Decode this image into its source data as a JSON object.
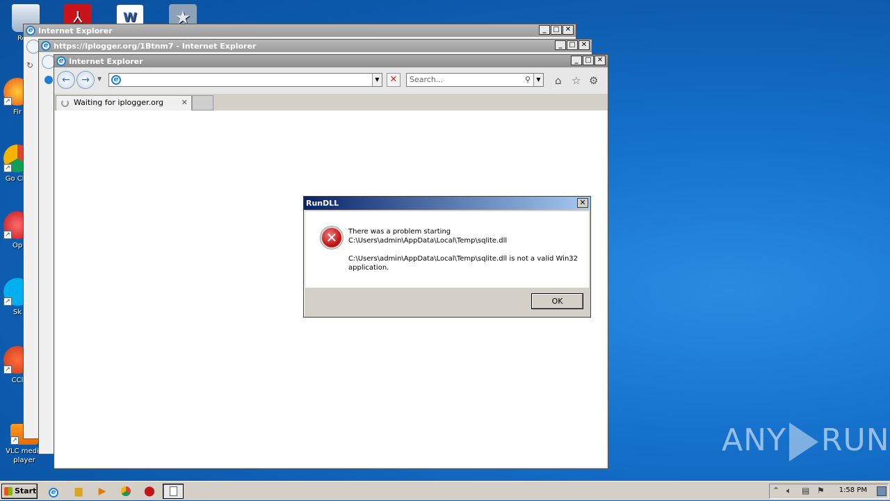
{
  "desktop_icons": [
    {
      "id": "recycle",
      "label": "Recy"
    },
    {
      "id": "acrobat",
      "label": ""
    },
    {
      "id": "word",
      "label": ""
    },
    {
      "id": "star",
      "label": ""
    },
    {
      "id": "firefox",
      "label": "Fir"
    },
    {
      "id": "chrome",
      "label": "Go Chr"
    },
    {
      "id": "opera",
      "label": "Op"
    },
    {
      "id": "skype",
      "label": "Sk"
    },
    {
      "id": "ccleaner",
      "label": "CCl"
    },
    {
      "id": "vlc",
      "label": "VLC media player"
    }
  ],
  "windows": {
    "back": {
      "title": "Internet Explorer"
    },
    "middle": {
      "title": "https://iplogger.org/1Btnm7 - Internet Explorer"
    },
    "front": {
      "title": "Internet Explorer",
      "address_value": "",
      "search_placeholder": "Search...",
      "tab_label": "Waiting for iplogger.org"
    }
  },
  "dialog": {
    "title": "RunDLL",
    "line1": "There was a problem starting",
    "line2": "C:\\Users\\admin\\AppData\\Local\\Temp\\sqlite.dll",
    "line3": "C:\\Users\\admin\\AppData\\Local\\Temp\\sqlite.dll is not a valid Win32",
    "line4": "application.",
    "ok_label": "OK"
  },
  "taskbar": {
    "start_label": "Start",
    "clock": "1:58 PM"
  },
  "watermark": {
    "left": "ANY",
    "right": "RUN"
  },
  "colors": {
    "dialog_title_start": "#0a246a",
    "dialog_title_end": "#a6caf0",
    "error_red": "#c21818"
  }
}
